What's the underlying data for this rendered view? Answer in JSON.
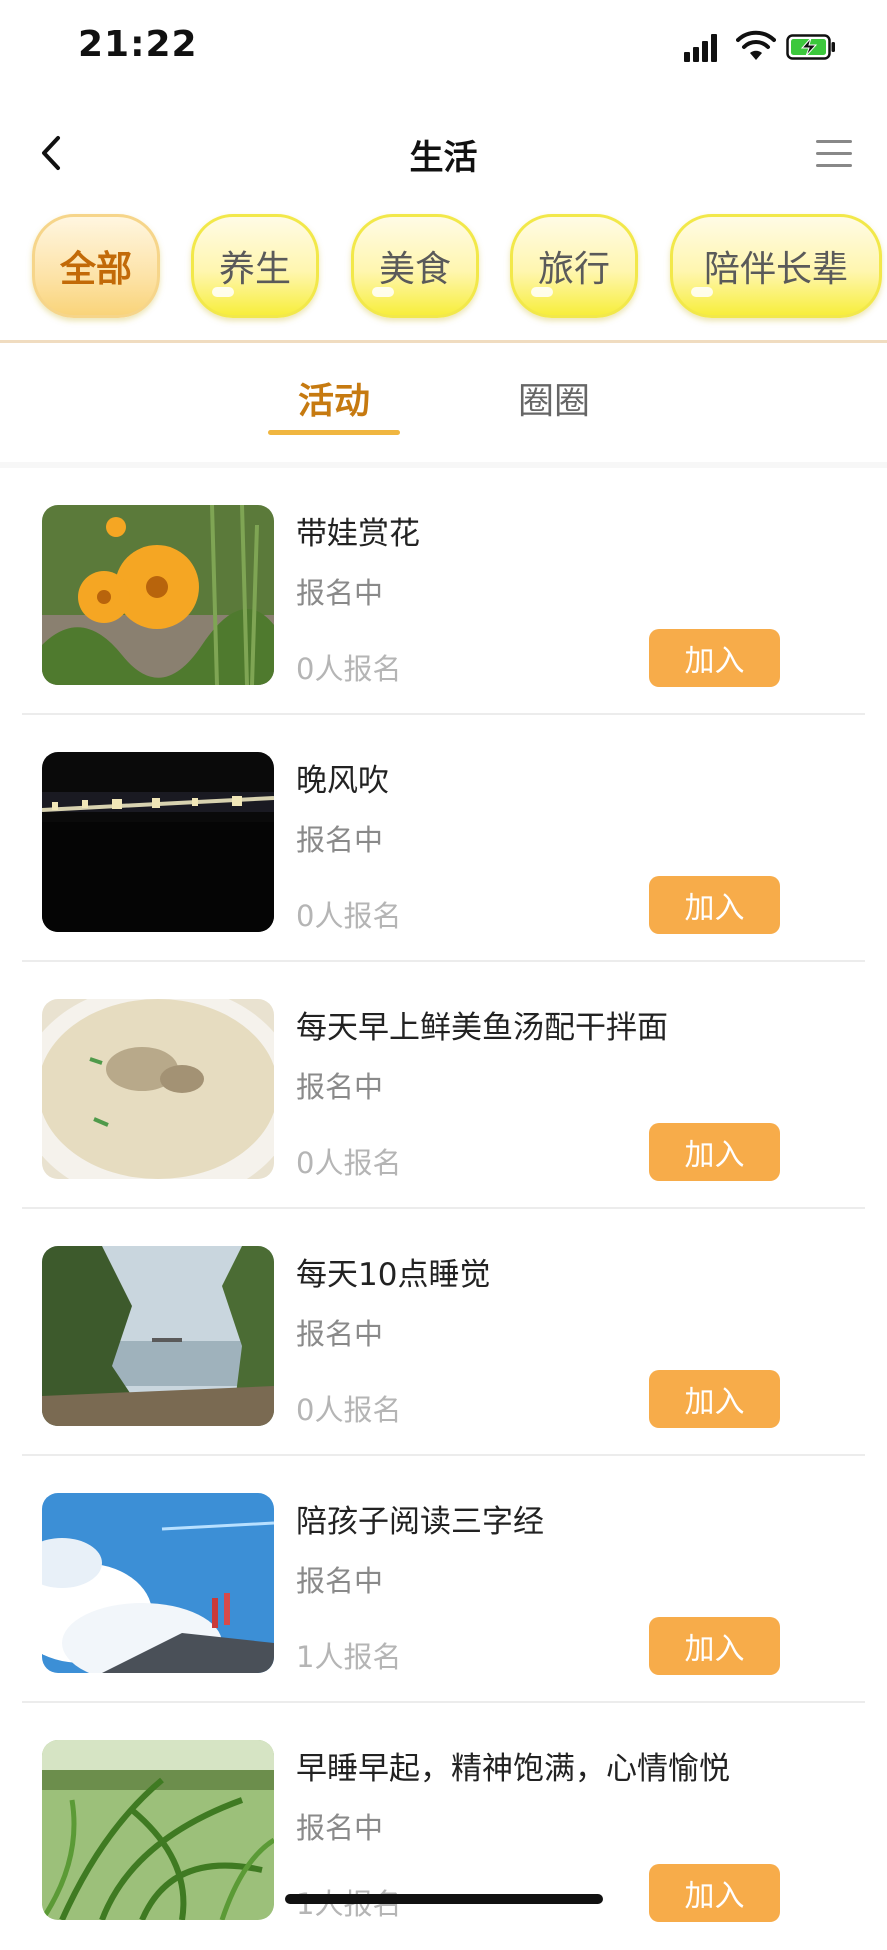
{
  "status_bar": {
    "time": "21:22"
  },
  "nav": {
    "title": "生活"
  },
  "categories": [
    {
      "label": "全部",
      "active": true
    },
    {
      "label": "养生",
      "active": false
    },
    {
      "label": "美食",
      "active": false
    },
    {
      "label": "旅行",
      "active": false
    },
    {
      "label": "陪伴长辈",
      "active": false
    }
  ],
  "tabs": [
    {
      "label": "活动",
      "active": true
    },
    {
      "label": "圈圈",
      "active": false
    }
  ],
  "activities": [
    {
      "title": "带娃赏花",
      "status": "报名中",
      "count": "0人报名",
      "join_label": "加入",
      "thumb": "orange-flowers-photo"
    },
    {
      "title": "晚风吹",
      "status": "报名中",
      "count": "0人报名",
      "join_label": "加入",
      "thumb": "night-bridge-photo"
    },
    {
      "title": "每天早上鲜美鱼汤配干拌面",
      "status": "报名中",
      "count": "0人报名",
      "join_label": "加入",
      "thumb": "fish-soup-photo"
    },
    {
      "title": "每天10点睡觉",
      "status": "报名中",
      "count": "0人报名",
      "join_label": "加入",
      "thumb": "lakeside-trees-photo"
    },
    {
      "title": "陪孩子阅读三字经",
      "status": "报名中",
      "count": "1人报名",
      "join_label": "加入",
      "thumb": "blue-sky-clouds-photo"
    },
    {
      "title": "早睡早起，精神饱满，心情愉悦",
      "status": "报名中",
      "count": "1人报名",
      "join_label": "加入",
      "thumb": "green-grass-photo"
    }
  ],
  "colors": {
    "accent": "#f7ac4a",
    "active_tab": "#c67a10",
    "active_category_text": "#c26a08",
    "pill_yellow": "#f7ee3c"
  }
}
